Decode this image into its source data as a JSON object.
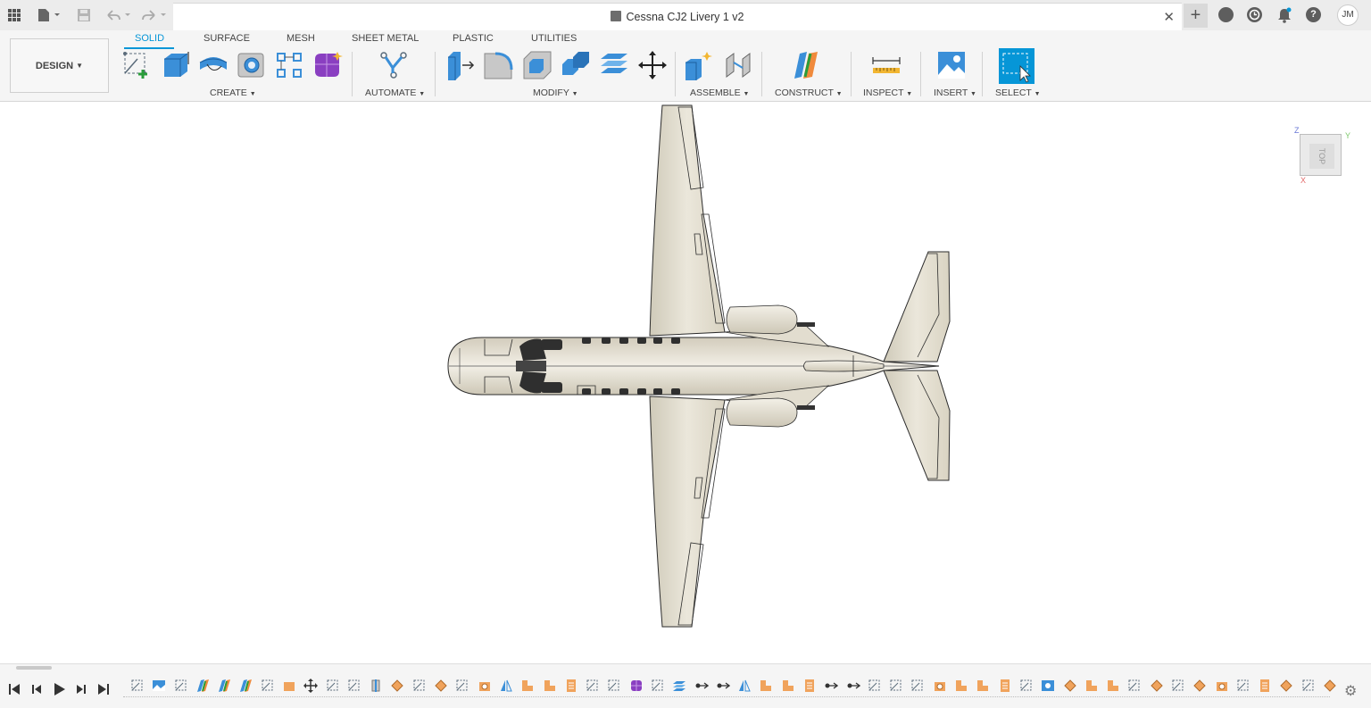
{
  "title_bar": {
    "document_title": "Cessna CJ2 Livery 1 v2",
    "close_glyph": "✕",
    "new_tab_glyph": "+",
    "help_glyph": "?",
    "user_initials": "JM",
    "icons": [
      "apps-grid-icon",
      "file-icon",
      "save-icon",
      "undo-icon",
      "redo-icon",
      "extensions-icon",
      "job-status-icon",
      "notifications-icon",
      "help-icon"
    ]
  },
  "workspace": {
    "label": "DESIGN"
  },
  "tabs": [
    {
      "label": "SOLID",
      "active": true
    },
    {
      "label": "SURFACE",
      "active": false
    },
    {
      "label": "MESH",
      "active": false
    },
    {
      "label": "SHEET METAL",
      "active": false
    },
    {
      "label": "PLASTIC",
      "active": false
    },
    {
      "label": "UTILITIES",
      "active": false
    }
  ],
  "groups": {
    "create": "CREATE",
    "automate": "AUTOMATE",
    "modify": "MODIFY",
    "assemble": "ASSEMBLE",
    "construct": "CONSTRUCT",
    "inspect": "INSPECT",
    "insert": "INSERT",
    "select": "SELECT"
  },
  "viewcube": {
    "face": "TOP",
    "axis_z": "Z",
    "axis_y": "Y",
    "axis_x": "X"
  },
  "colors": {
    "accent": "#0696d7",
    "airframe": "#e6e1d4",
    "outline": "#2b2b2b",
    "feature_orange": "#f0a35c"
  },
  "timeline": {
    "controls": [
      "first-step-icon",
      "previous-step-icon",
      "play-icon",
      "next-step-icon",
      "last-step-icon"
    ],
    "feature_count": 56
  }
}
